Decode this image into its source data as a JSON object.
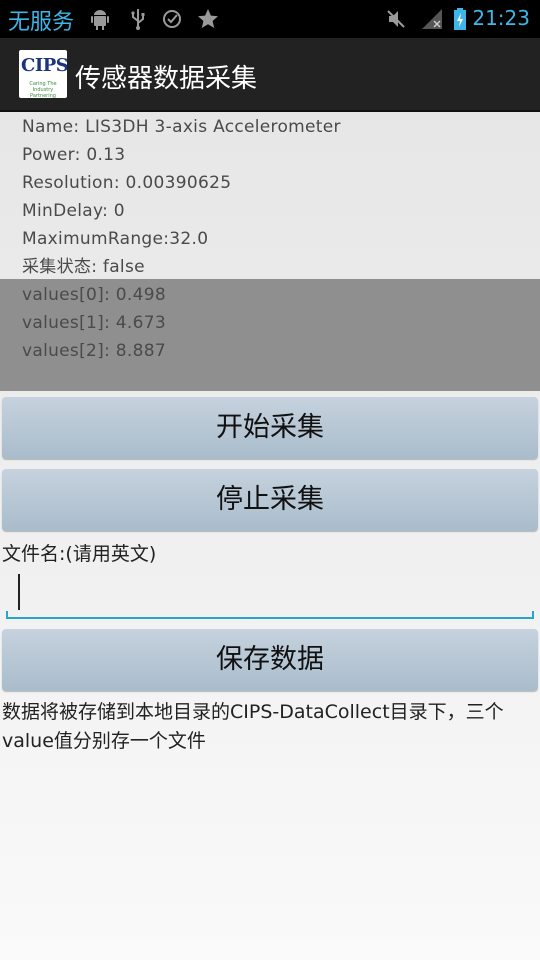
{
  "status_bar": {
    "carrier": "无服务",
    "time": "21:23",
    "icons": [
      "android-debug-icon",
      "usb-icon",
      "sync-failed-icon",
      "star-icon",
      "mute-icon",
      "no-signal-icon",
      "battery-charging-icon"
    ]
  },
  "action_bar": {
    "logo_text": "CIPS",
    "logo_subtext": "Caring The Industry Partnering Society",
    "title": "传感器数据采集"
  },
  "sensor_info": {
    "name": "Name:  LIS3DH 3-axis Accelerometer",
    "power": "Power: 0.13",
    "resolution": "Resolution: 0.00390625",
    "min_delay": "MinDelay: 0",
    "max_range": "MaximumRange:32.0",
    "status": "采集状态: false",
    "values": [
      "values[0]: 0.498",
      "values[1]: 4.673",
      "values[2]: 8.887"
    ]
  },
  "buttons": {
    "start": "开始采集",
    "stop": "停止采集",
    "save": "保存数据"
  },
  "filename": {
    "label": "文件名:(请用英文)",
    "value": ""
  },
  "note": "数据将被存储到本地目录的CIPS-DataCollect目录下，三个value值分别存一个文件",
  "colors": {
    "accent": "#3fb6e8",
    "button": "#b8c8d6",
    "input_line": "#2aa5c9"
  }
}
